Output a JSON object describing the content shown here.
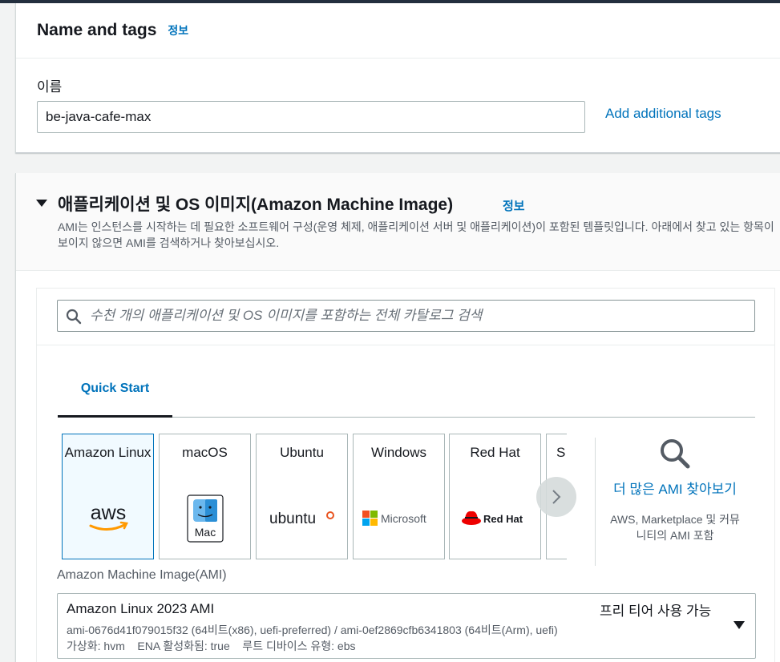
{
  "name_tags": {
    "title": "Name and tags",
    "info": "정보",
    "name_label": "이름",
    "name_value": "be-java-cafe-max",
    "add_tags": "Add additional tags"
  },
  "ami_section": {
    "title": "애플리케이션 및 OS 이미지(Amazon Machine Image)",
    "info": "정보",
    "description": "AMI는 인스턴스를 시작하는 데 필요한 소프트웨어 구성(운영 체제, 애플리케이션 서버 및 애플리케이션)이 포함된 템플릿입니다. 아래에서 찾고 있는 항목이 보이지 않으면 AMI를 검색하거나 찾아보십시오.",
    "search_placeholder": "수천 개의 애플리케이션 및 OS 이미지를 포함하는 전체 카탈로그 검색",
    "tab_quick_start": "Quick Start",
    "tiles": [
      {
        "label": "Amazon Linux",
        "logo": "aws",
        "selected": true
      },
      {
        "label": "macOS",
        "logo": "Mac",
        "selected": false
      },
      {
        "label": "Ubuntu",
        "logo": "ubuntu",
        "selected": false
      },
      {
        "label": "Windows",
        "logo": "Microsoft",
        "selected": false
      },
      {
        "label": "Red Hat",
        "logo": "Red Hat",
        "selected": false
      },
      {
        "label": "S",
        "logo": "",
        "selected": false
      }
    ],
    "more_link": "더 많은 AMI 찾아보기",
    "more_sub": "AWS, Marketplace 및 커뮤니티의 AMI 포함",
    "ami_label": "Amazon Machine Image(AMI)",
    "selected_ami": {
      "name": "Amazon Linux 2023 AMI",
      "free_tier": "프리 티어 사용 가능",
      "ids": "ami-0676d41f079015f32 (64비트(x86), uefi-preferred) / ami-0ef2869cfb6341803 (64비트(Arm), uefi)",
      "attrs": "가상화: hvm    ENA 활성화됨: true    루트 디바이스 유형: ebs"
    }
  },
  "colors": {
    "link": "#0073bb",
    "selected_tile_border": "#0073bb",
    "header_bar": "#232f3e"
  }
}
